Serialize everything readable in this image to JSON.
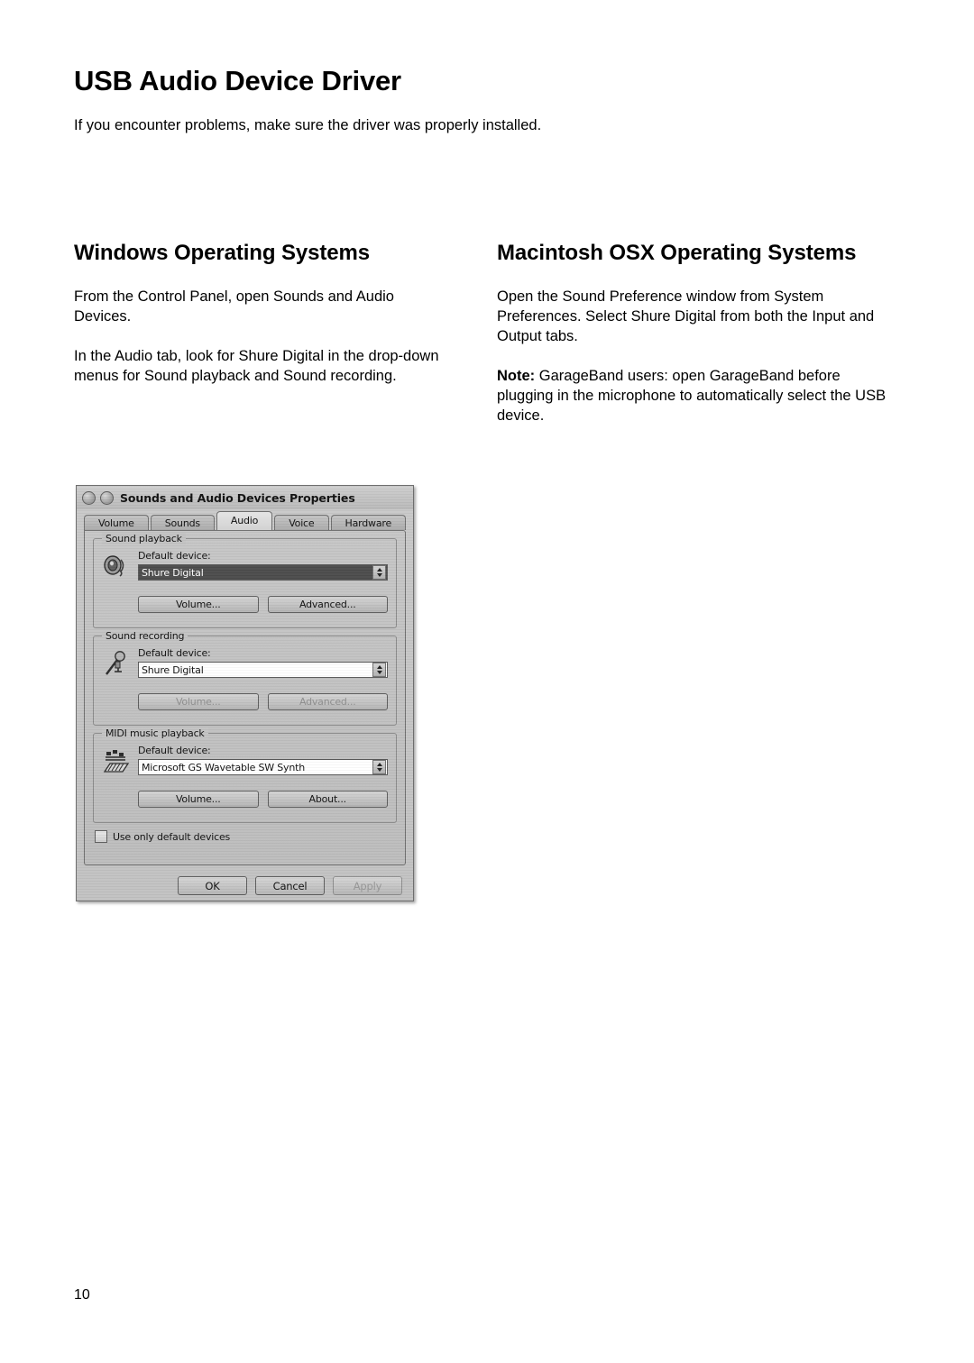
{
  "page": {
    "title": "USB Audio Device Driver",
    "intro": "If you encounter problems, make sure the driver was properly installed.",
    "page_number": "10"
  },
  "windows_column": {
    "heading": "Windows Operating Systems",
    "paragraph_1": "From the Control Panel, open Sounds and Audio Devices.",
    "paragraph_2": "In the Audio tab, look for Shure Digital in the drop-down menus for Sound playback and Sound recording."
  },
  "macintosh_column": {
    "heading": "Macintosh OSX Operating Systems",
    "paragraph_1": "Open the Sound Preference window from System Preferences. Select Shure Digital from both the Input and Output tabs.",
    "note_label": "Note:",
    "note_text": " GarageBand users: open GarageBand before plugging in the microphone to automatically select the USB device."
  },
  "dialog": {
    "title": "Sounds and Audio Devices Properties",
    "tabs": [
      {
        "label": "Volume",
        "active": false
      },
      {
        "label": "Sounds",
        "active": false
      },
      {
        "label": "Audio",
        "active": true
      },
      {
        "label": "Voice",
        "active": false
      },
      {
        "label": "Hardware",
        "active": false
      }
    ],
    "sound_playback": {
      "group_title": "Sound playback",
      "field_label": "Default device:",
      "device_value": "Shure Digital",
      "device_selected": true,
      "icon": "speaker-icon",
      "buttons": [
        {
          "label": "Volume...",
          "disabled": false
        },
        {
          "label": "Advanced...",
          "disabled": false
        }
      ]
    },
    "sound_recording": {
      "group_title": "Sound recording",
      "field_label": "Default device:",
      "device_value": "Shure Digital",
      "device_selected": false,
      "icon": "microphone-icon",
      "buttons": [
        {
          "label": "Volume...",
          "disabled": true
        },
        {
          "label": "Advanced...",
          "disabled": true
        }
      ]
    },
    "midi_playback": {
      "group_title": "MIDI music playback",
      "field_label": "Default device:",
      "device_value": "Microsoft GS Wavetable SW Synth",
      "device_selected": false,
      "icon": "midi-keyboard-icon",
      "buttons": [
        {
          "label": "Volume...",
          "disabled": false
        },
        {
          "label": "About...",
          "disabled": false
        }
      ]
    },
    "use_only_default_devices": {
      "label": "Use only default devices",
      "checked": false
    },
    "footer_buttons": [
      {
        "label": "OK",
        "disabled": false
      },
      {
        "label": "Cancel",
        "disabled": false
      },
      {
        "label": "Apply",
        "disabled": true
      }
    ]
  },
  "colors": {
    "page_background": "#ffffff",
    "text": "#000000",
    "dialog_face": "#c3c3c3",
    "combo_selected_bg": "#4c4c4c",
    "disabled_text": "#8e8e8e"
  }
}
